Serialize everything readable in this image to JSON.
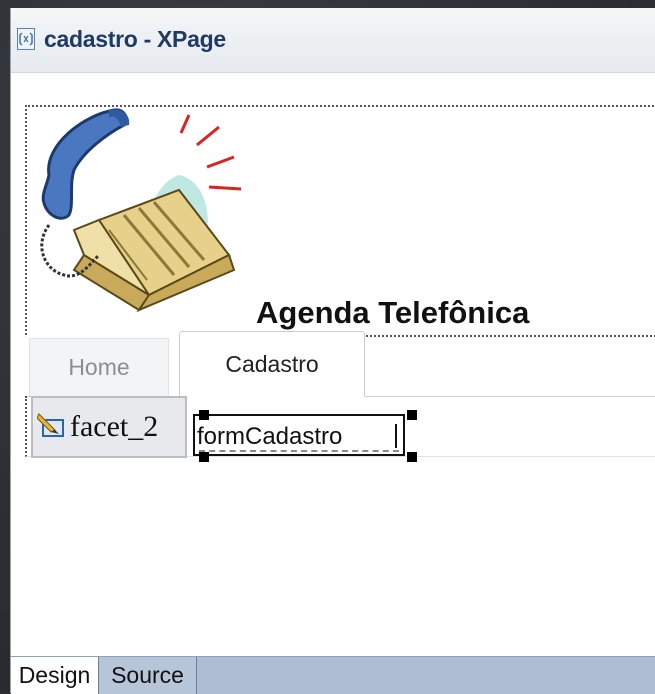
{
  "window": {
    "title": "cadastro - XPage",
    "icon": "xpage-file-icon"
  },
  "header": {
    "app_title": "Agenda Telefônica",
    "logo": "telephone-and-book-image"
  },
  "tabs": [
    {
      "label": "Home",
      "active": false
    },
    {
      "label": "Cadastro",
      "active": true
    }
  ],
  "body": {
    "facet_label": "facet_2",
    "facet_icon": "pencil-edit-icon",
    "form_label": "formCadastro"
  },
  "editor_tabs": [
    {
      "label": "Design",
      "active": true
    },
    {
      "label": "Source",
      "active": false
    }
  ],
  "colors": {
    "title_text": "#1f3a63",
    "bottom_bar": "#aebdd2",
    "tab_inactive_text": "#8a8f96"
  }
}
